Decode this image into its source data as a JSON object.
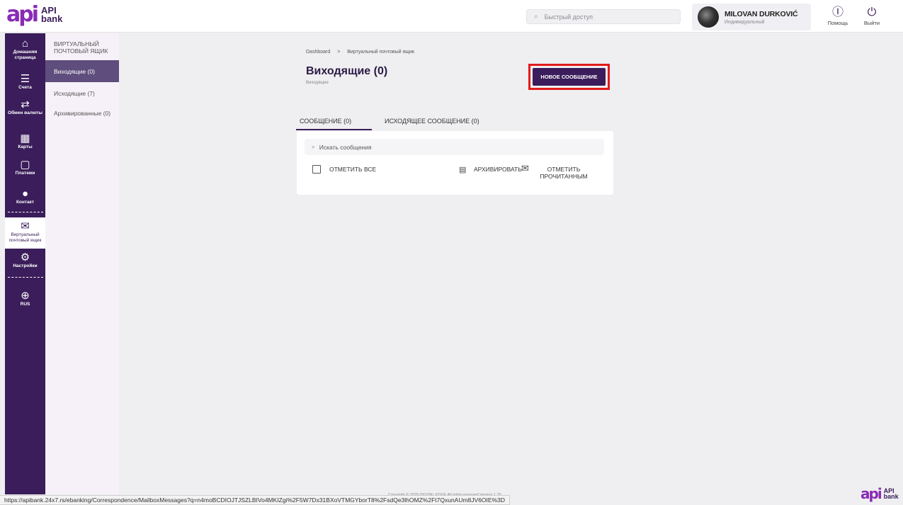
{
  "logo": {
    "mark": "api",
    "line1": "API",
    "line2": "bank"
  },
  "header": {
    "search_placeholder": "Быстрый доступ",
    "user_name": "MILOVAN DURKOVIĆ",
    "user_role": "Индивидуальный",
    "help_label": "Помощь",
    "logout_label": "Выйти"
  },
  "rail": [
    {
      "icon": "home-icon",
      "label": "Домашняя страница"
    },
    {
      "icon": "list-icon",
      "label": "Счета"
    },
    {
      "icon": "exchange-icon",
      "label": "Обмен валюты"
    },
    {
      "icon": "card-icon",
      "label": "Карты"
    },
    {
      "icon": "wallet-icon",
      "label": "Платежи"
    },
    {
      "icon": "contact-icon",
      "label": "Контакт"
    },
    {
      "icon": "mail-icon",
      "label": "Виртуальный почтовый ящик"
    },
    {
      "icon": "gear-icon",
      "label": "Настройки"
    },
    {
      "icon": "globe-icon",
      "label": "RUS"
    }
  ],
  "subside": {
    "heading": "ВИРТУАЛЬНЫЙ ПОЧТОВЫЙ ЯЩИК",
    "items": [
      "Виходящие (0)",
      "Исходящие (7)",
      "Архивированные (0)"
    ]
  },
  "main": {
    "breadcrumb_home": "Dashboard",
    "breadcrumb_sep": ">",
    "breadcrumb_current": "Виртуальный почтовый ящик",
    "title": "Виходящие (0)",
    "subtitle": "Виходящие",
    "new_message_button": "НОВОЕ СООБЩЕНИЕ",
    "tabs": [
      "СООБЩЕНИЕ (0)",
      "ИСХОДЯЩЕЕ СООБЩЕНИЕ (0)"
    ],
    "search_placeholder": "Искать сообщения",
    "select_all": "ОТМЕТИТЬ ВСЕ",
    "archive": "АРХИВИРОВАТЬ",
    "mark_read": "ОТМЕТИТЬ ПРОЧИТАННЫМ"
  },
  "footer": {
    "copyright": "Copyright © 2020 DIGITAL EDGE All rights reserved Version 1.76",
    "status_url": "https://apibank.24x7.rs/ebanking/Correspondence/MailboxMessages?q=n4moBCDIOJTJSZLBIVo4MKIZgi%2F5W7Dx31BXoVTMGYborT8%2FsdQe3lhOMZ%2Ft7QxunAUm8JV6OIE%3D"
  },
  "colors": {
    "brand": "#3a1d5a",
    "accent": "#8a2bb5",
    "highlight": "#e21b1b",
    "sub_active": "#5f4d7d"
  }
}
